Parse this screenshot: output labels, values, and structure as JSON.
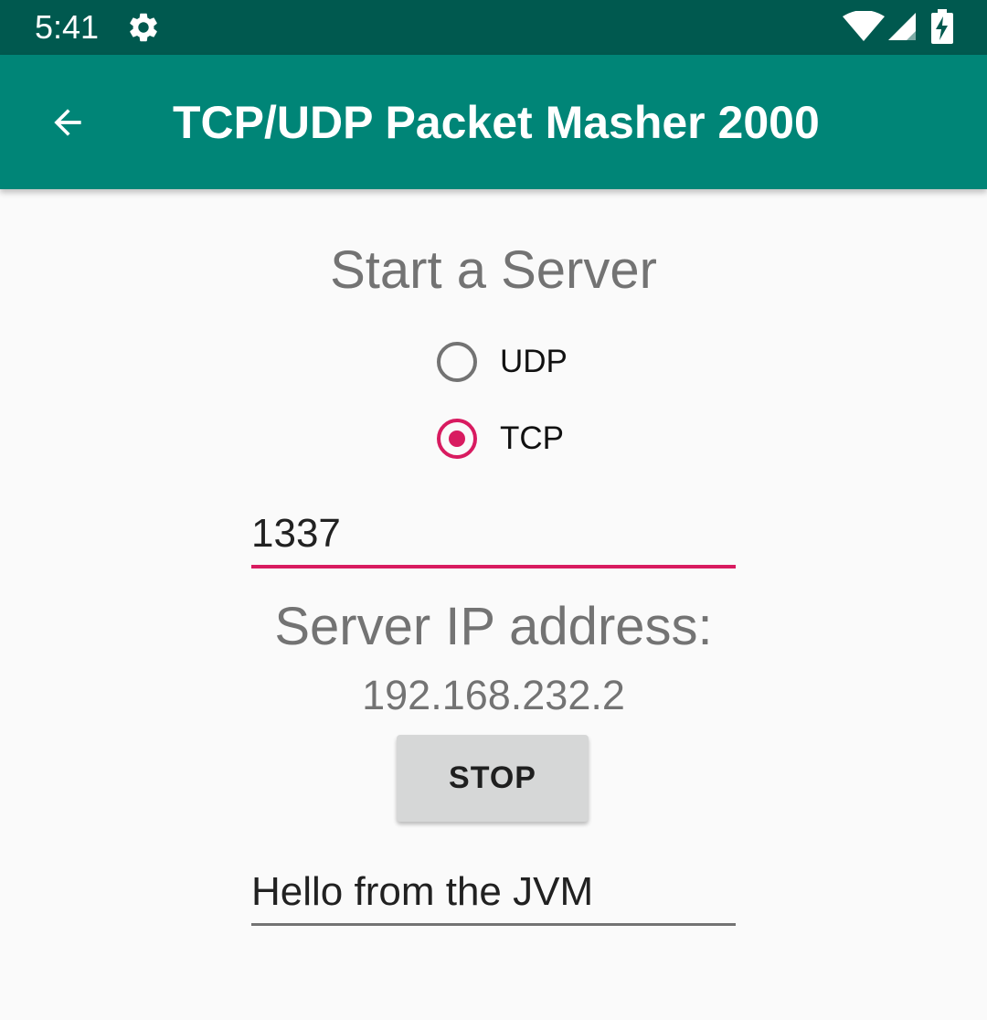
{
  "status_bar": {
    "time": "5:41",
    "icons": [
      "gear-icon",
      "wifi-icon",
      "signal-icon",
      "battery-charging-icon"
    ],
    "color": "#00594f"
  },
  "app_bar": {
    "title": "TCP/UDP Packet Masher 2000",
    "back_icon": "arrow-left-icon",
    "color": "#008577"
  },
  "main": {
    "heading": "Start a Server",
    "protocols": [
      {
        "label": "UDP",
        "checked": false
      },
      {
        "label": "TCP",
        "checked": true
      }
    ],
    "port_value": "1337",
    "ip_label": "Server IP address:",
    "ip_value": "192.168.232.2",
    "stop_label": "STOP",
    "message_value": "Hello from the JVM"
  },
  "colors": {
    "accent": "#d81b60",
    "secondary_text": "#737373",
    "button_bg": "#d6d7d7"
  }
}
